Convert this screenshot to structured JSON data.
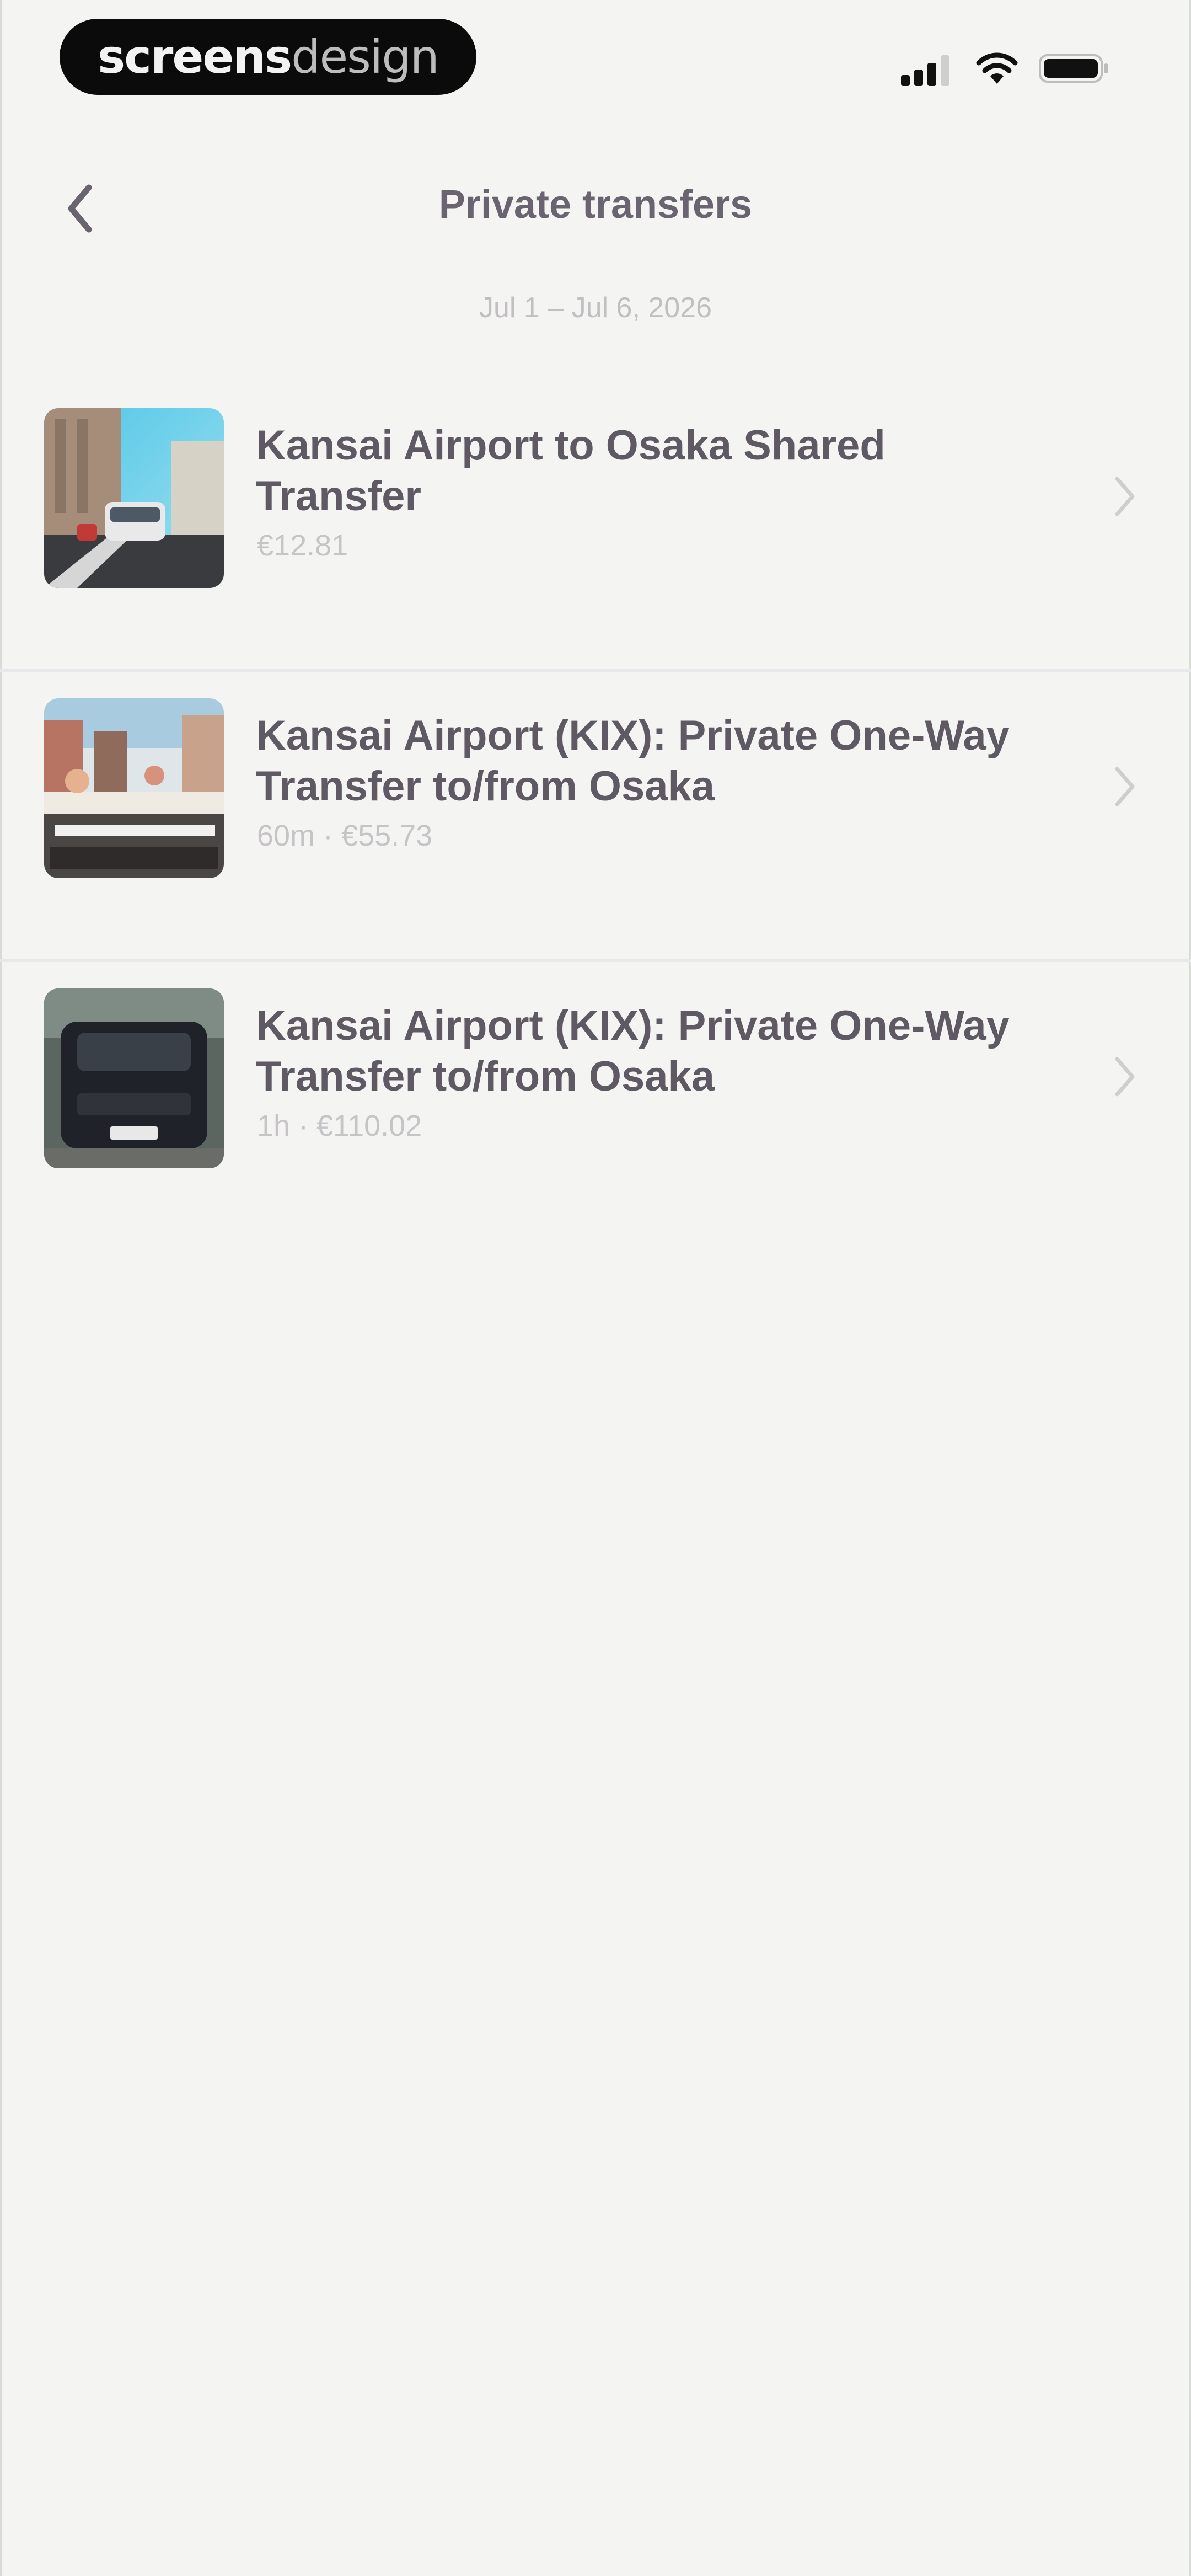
{
  "status_bar": {
    "logo_bold": "screens",
    "logo_light": "design"
  },
  "header": {
    "title": "Private transfers",
    "dates": "Jul 1 – Jul 6, 2026"
  },
  "transfers": [
    {
      "title": "Kansai Airport to Osaka Shared Transfer",
      "meta": "€12.81"
    },
    {
      "title": "Kansai Airport (KIX): Private One-Way Transfer to/from Osaka",
      "meta": "60m · €55.73"
    },
    {
      "title": "Kansai Airport (KIX): Private One-Way Transfer to/from Osaka",
      "meta": "1h · €110.02"
    }
  ],
  "colors": {
    "background": "#f4f4f2",
    "title_text": "#6a6470",
    "muted_text": "#c2bfc2",
    "divider": "#e8e7ea"
  }
}
